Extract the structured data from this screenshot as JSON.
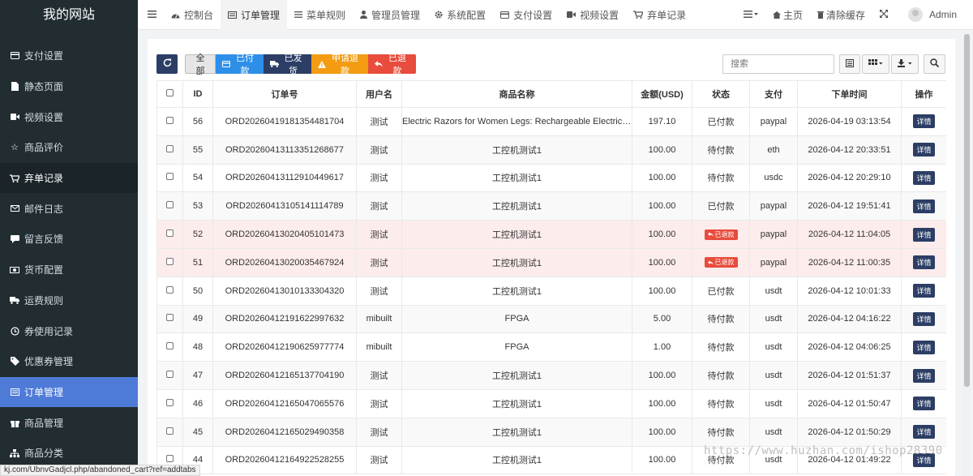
{
  "sidebar": {
    "logo": "我的网站",
    "items": [
      {
        "label": "支付设置",
        "icon": "credit-card-icon"
      },
      {
        "label": "静态页面",
        "icon": "file-icon"
      },
      {
        "label": "视频设置",
        "icon": "video-icon"
      },
      {
        "label": "商品评价",
        "icon": "star-icon"
      },
      {
        "label": "弃单记录",
        "icon": "cart-icon"
      },
      {
        "label": "邮件日志",
        "icon": "mail-icon"
      },
      {
        "label": "留言反馈",
        "icon": "comment-icon"
      },
      {
        "label": "货币配置",
        "icon": "money-icon"
      },
      {
        "label": "运费规则",
        "icon": "truck-icon"
      },
      {
        "label": "券使用记录",
        "icon": "history-icon"
      },
      {
        "label": "优惠券管理",
        "icon": "tag-icon"
      },
      {
        "label": "订单管理",
        "icon": "list-icon"
      },
      {
        "label": "商品管理",
        "icon": "gift-icon"
      },
      {
        "label": "商品分类",
        "icon": "sitemap-icon"
      }
    ]
  },
  "topnav": {
    "items": [
      {
        "label": "控制台",
        "icon": "dashboard-icon"
      },
      {
        "label": "订单管理",
        "icon": "list-icon"
      },
      {
        "label": "菜单规则",
        "icon": "bars-icon"
      },
      {
        "label": "管理员管理",
        "icon": "user-icon"
      },
      {
        "label": "系统配置",
        "icon": "gear-icon"
      },
      {
        "label": "支付设置",
        "icon": "credit-card-icon"
      },
      {
        "label": "视频设置",
        "icon": "video-icon"
      },
      {
        "label": "弃单记录",
        "icon": "cart-icon"
      }
    ],
    "home": "主页",
    "clear_cache": "清除缓存",
    "admin": "Admin"
  },
  "toolbar": {
    "all": "全部",
    "paid": "已付款",
    "shipped": "已发货",
    "apply_refund": "申请退款",
    "refunded": "已退款",
    "search_placeholder": "搜索"
  },
  "table": {
    "headers": [
      "ID",
      "订单号",
      "用户名",
      "商品名称",
      "金额(USD)",
      "状态",
      "支付",
      "下单时间",
      "操作"
    ],
    "detail_label": "详情",
    "rows": [
      {
        "id": "56",
        "order": "ORD20260419181354481704",
        "user": "测试",
        "product": "Electric Razors for Women Legs: Rechargeable Electric Shaver",
        "amount": "197.10",
        "status": "已付款",
        "pay": "paypal",
        "time": "2026-04-19 03:13:54"
      },
      {
        "id": "55",
        "order": "ORD20260413113351268677",
        "user": "测试",
        "product": "工控机测试1",
        "amount": "100.00",
        "status": "待付款",
        "pay": "eth",
        "time": "2026-04-12 20:33:51"
      },
      {
        "id": "54",
        "order": "ORD20260413112910449617",
        "user": "测试",
        "product": "工控机测试1",
        "amount": "100.00",
        "status": "待付款",
        "pay": "usdc",
        "time": "2026-04-12 20:29:10"
      },
      {
        "id": "53",
        "order": "ORD20260413105141114789",
        "user": "测试",
        "product": "工控机测试1",
        "amount": "100.00",
        "status": "已付款",
        "pay": "paypal",
        "time": "2026-04-12 19:51:41"
      },
      {
        "id": "52",
        "order": "ORD20260413020405101473",
        "user": "测试",
        "product": "工控机测试1",
        "amount": "100.00",
        "status": "已退款",
        "pay": "paypal",
        "time": "2026-04-12 11:04:05"
      },
      {
        "id": "51",
        "order": "ORD20260413020035467924",
        "user": "测试",
        "product": "工控机测试1",
        "amount": "100.00",
        "status": "已退款",
        "pay": "paypal",
        "time": "2026-04-12 11:00:35"
      },
      {
        "id": "50",
        "order": "ORD20260413010133304320",
        "user": "测试",
        "product": "工控机测试1",
        "amount": "100.00",
        "status": "已付款",
        "pay": "usdt",
        "time": "2026-04-12 10:01:33"
      },
      {
        "id": "49",
        "order": "ORD20260412191622997632",
        "user": "mibuilt",
        "product": "FPGA",
        "amount": "5.00",
        "status": "待付款",
        "pay": "usdt",
        "time": "2026-04-12 04:16:22"
      },
      {
        "id": "48",
        "order": "ORD20260412190625977774",
        "user": "mibuilt",
        "product": "FPGA",
        "amount": "1.00",
        "status": "待付款",
        "pay": "usdt",
        "time": "2026-04-12 04:06:25"
      },
      {
        "id": "47",
        "order": "ORD20260412165137704190",
        "user": "测试",
        "product": "工控机测试1",
        "amount": "100.00",
        "status": "待付款",
        "pay": "usdt",
        "time": "2026-04-12 01:51:37"
      },
      {
        "id": "46",
        "order": "ORD20260412165047065576",
        "user": "测试",
        "product": "工控机测试1",
        "amount": "100.00",
        "status": "待付款",
        "pay": "usdt",
        "time": "2026-04-12 01:50:47"
      },
      {
        "id": "45",
        "order": "ORD20260412165029490358",
        "user": "测试",
        "product": "工控机测试1",
        "amount": "100.00",
        "status": "待付款",
        "pay": "usdt",
        "time": "2026-04-12 01:50:29"
      },
      {
        "id": "44",
        "order": "ORD20260412164922528255",
        "user": "测试",
        "product": "工控机测试1",
        "amount": "100.00",
        "status": "待付款",
        "pay": "usdt",
        "time": "2026-04-12 01:49:22"
      }
    ]
  },
  "statusbar": "kj.com/UbnvGadjcl.php/abandoned_cart?ref=addtabs",
  "watermark": "https://www.huzhan.com/ishop28390",
  "colors": {
    "sidebar_bg": "#222d32",
    "sidebar_active": "#4f7bd8",
    "primary_dark": "#2c3e65",
    "info": "#2d8fe8",
    "warning": "#f39c12",
    "danger": "#e74c3c"
  }
}
